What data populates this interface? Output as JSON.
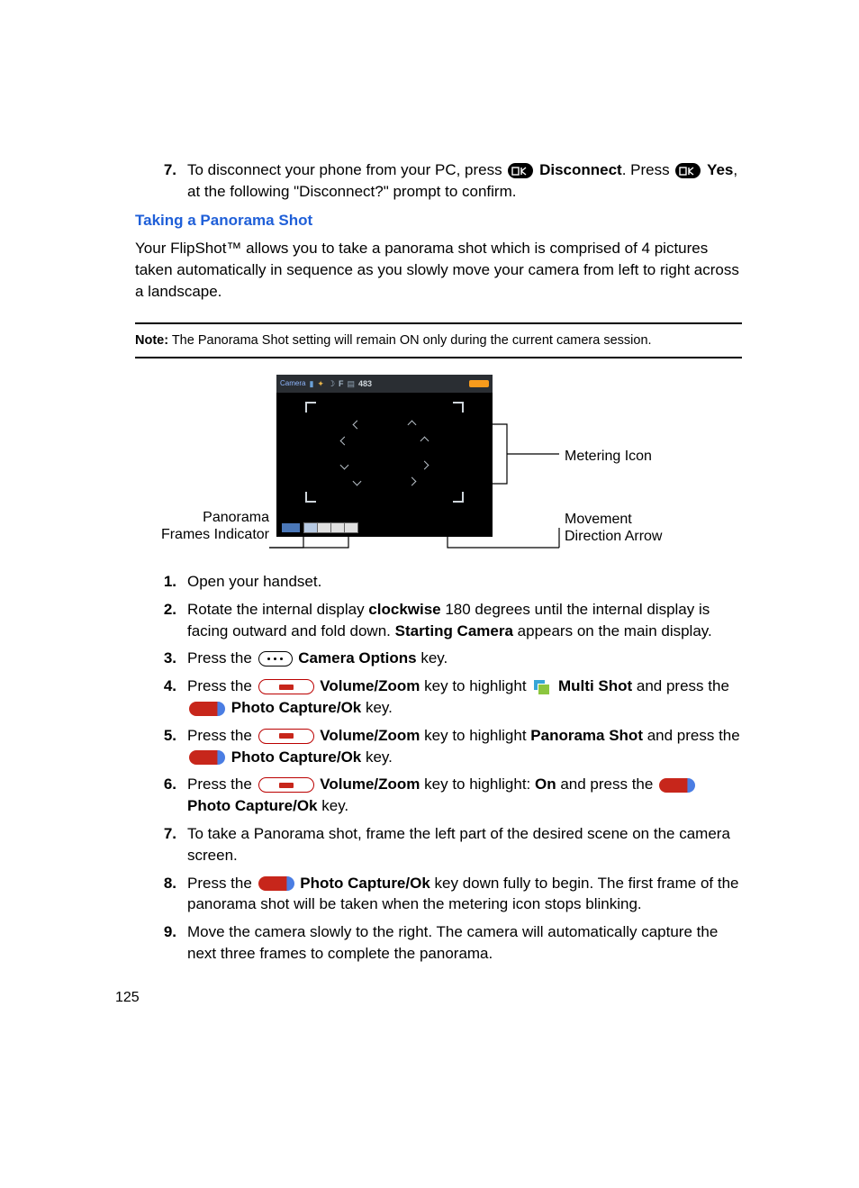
{
  "topStep": {
    "num": "7.",
    "t1": "To disconnect your phone from your PC, press ",
    "disconnect": "Disconnect",
    "t2": ". Press ",
    "yes": "Yes",
    "t3": ", at the following \"Disconnect?\" prompt to confirm."
  },
  "sectionTitle": "Taking a Panorama Shot",
  "intro": "Your FlipShot™ allows you to take a panorama shot which is comprised of 4 pictures taken automatically in sequence as you slowly move your camera from left to right across a landscape.",
  "note": {
    "label": "Note:",
    "text": " The Panorama Shot setting will remain ON only during the current camera session."
  },
  "diagram": {
    "metering": "Metering Icon",
    "panorama1": "Panorama",
    "panorama2": "Frames Indicator",
    "movement1": "Movement",
    "movement2": "Direction Arrow",
    "topbar": {
      "camera": "Camera",
      "num": "483"
    }
  },
  "steps": [
    {
      "num": "1.",
      "segs": [
        {
          "t": "Open your handset."
        }
      ]
    },
    {
      "num": "2.",
      "segs": [
        {
          "t": "Rotate the internal display "
        },
        {
          "b": "clockwise"
        },
        {
          "t": " 180 degrees until the internal display is facing outward and fold down. "
        },
        {
          "b": "Starting Camera"
        },
        {
          "t": " appears on the main display."
        }
      ]
    },
    {
      "num": "3.",
      "segs": [
        {
          "t": "Press the "
        },
        {
          "icon": "dots"
        },
        {
          "t": " "
        },
        {
          "b": "Camera Options"
        },
        {
          "t": " key."
        }
      ]
    },
    {
      "num": "4.",
      "segs": [
        {
          "t": "Press the "
        },
        {
          "icon": "vol"
        },
        {
          "t": " "
        },
        {
          "b": "Volume/Zoom"
        },
        {
          "t": " key to highlight "
        },
        {
          "icon": "multi"
        },
        {
          "t": " "
        },
        {
          "b": "Multi Shot"
        },
        {
          "t": " and press the "
        },
        {
          "icon": "photo"
        },
        {
          "t": " "
        },
        {
          "b": "Photo Capture/Ok"
        },
        {
          "t": " key."
        }
      ]
    },
    {
      "num": "5.",
      "segs": [
        {
          "t": "Press the "
        },
        {
          "icon": "vol"
        },
        {
          "t": " "
        },
        {
          "b": "Volume/Zoom"
        },
        {
          "t": " key to highlight "
        },
        {
          "b": "Panorama Shot"
        },
        {
          "t": " and press the "
        },
        {
          "icon": "photo"
        },
        {
          "t": " "
        },
        {
          "b": "Photo Capture/Ok"
        },
        {
          "t": " key."
        }
      ]
    },
    {
      "num": "6.",
      "segs": [
        {
          "t": "Press the "
        },
        {
          "icon": "vol"
        },
        {
          "t": " "
        },
        {
          "b": "Volume/Zoom"
        },
        {
          "t": " key to highlight: "
        },
        {
          "b": "On"
        },
        {
          "t": " and press the "
        },
        {
          "icon": "photo"
        },
        {
          "t": " "
        },
        {
          "b": "Photo Capture/Ok"
        },
        {
          "t": " key."
        }
      ]
    },
    {
      "num": "7.",
      "segs": [
        {
          "t": "To take a Panorama shot, frame the left part of the desired scene on the camera screen."
        }
      ]
    },
    {
      "num": "8.",
      "segs": [
        {
          "t": "Press the "
        },
        {
          "icon": "photo"
        },
        {
          "t": " "
        },
        {
          "b": "Photo Capture/Ok"
        },
        {
          "t": " key down fully to begin. The first frame of the panorama shot will be taken when the metering icon stops blinking."
        }
      ]
    },
    {
      "num": "9.",
      "segs": [
        {
          "t": "Move the camera slowly to the right. The camera will automatically capture the next three frames to complete the panorama."
        }
      ]
    }
  ],
  "pageNumber": "125"
}
